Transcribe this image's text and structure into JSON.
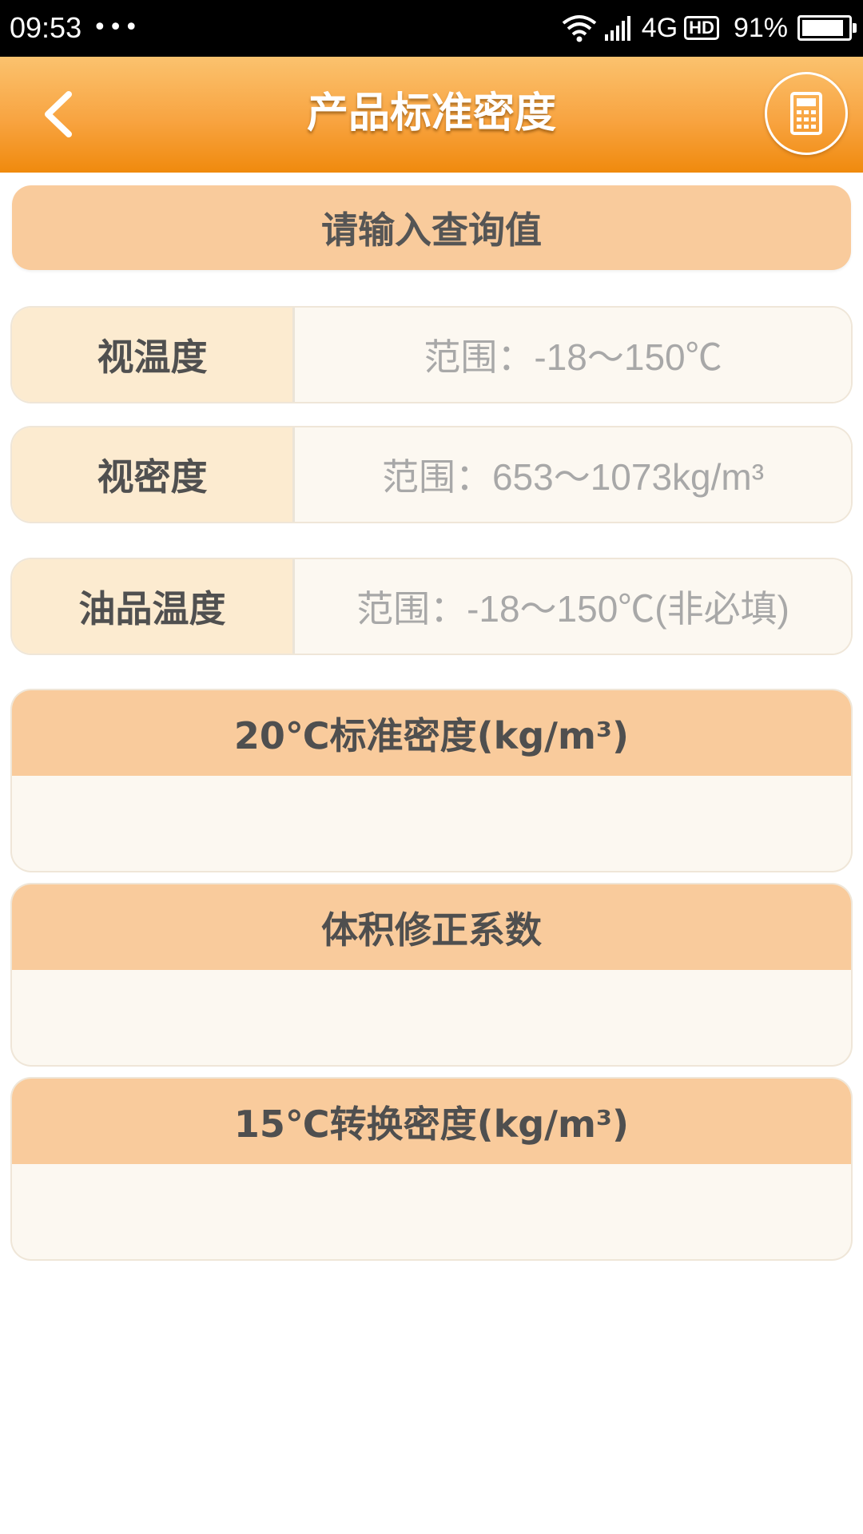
{
  "status_bar": {
    "time": "09:53",
    "dots": "•••",
    "network": "4G",
    "hd": "HD",
    "battery_percent": "91%",
    "battery_level": 0.91
  },
  "header": {
    "title": "产品标准密度",
    "back_icon": "chevron-left-icon",
    "calculator_icon": "calculator-icon"
  },
  "query_banner": {
    "label": "请输入查询值"
  },
  "inputs": [
    {
      "label": "视温度",
      "value": "",
      "placeholder": "范围：-18～150℃"
    },
    {
      "label": "视密度",
      "value": "",
      "placeholder": "范围：653～1073kg/m³"
    },
    {
      "label": "油品温度",
      "value": "",
      "placeholder": "范围：-18～150℃(非必填)"
    }
  ],
  "results": [
    {
      "title": "20℃标准密度(kg/m³)",
      "value": ""
    },
    {
      "title": "体积修正系数",
      "value": ""
    },
    {
      "title": "15℃转换密度(kg/m³)",
      "value": ""
    }
  ],
  "colors": {
    "header_top": "#fbc26e",
    "header_bottom": "#f08a0d",
    "banner": "#f9cb9c",
    "label_bg": "#fcebd0",
    "field_bg": "#fcf8f1"
  }
}
